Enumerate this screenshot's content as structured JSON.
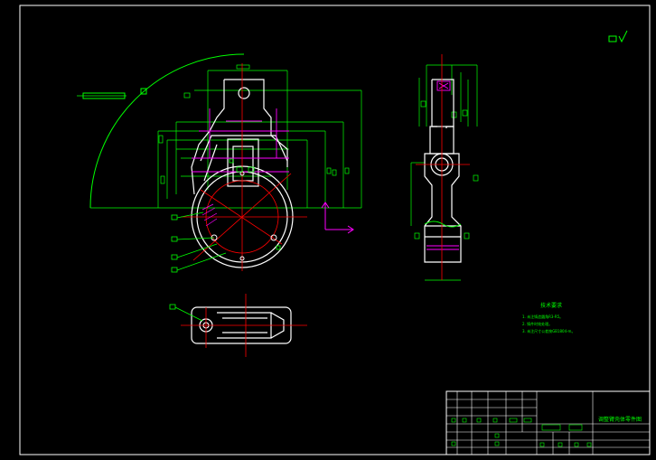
{
  "drawing": {
    "title_block": {
      "drawing_title": "调整臂壳体零件图"
    },
    "technical_requirements": {
      "heading": "技术要求",
      "items": [
        "1. 未注铸造圆角R3-R5。",
        "2. 铸件时效处理。",
        "3. 未注尺寸公差按GB1804-m。"
      ]
    },
    "colors": {
      "background": "#000000",
      "outline": "#ffffff",
      "dimension": "#00ff00",
      "centerline": "#ff0000",
      "hidden": "#ff00ff",
      "axis_marker": "#ff00ff",
      "text": "#00ff00"
    }
  }
}
